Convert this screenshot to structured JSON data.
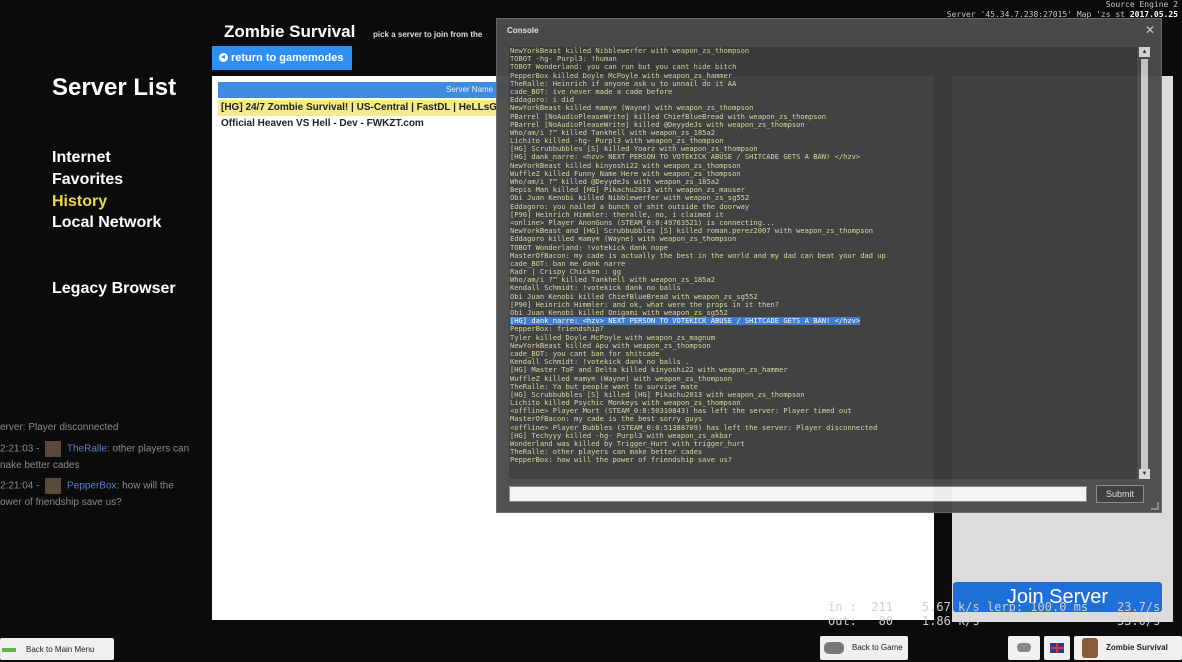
{
  "hud": {
    "engine": "Source Engine 2",
    "server_info": "Server '45.34.7.238:27015' Map 'zs_st",
    "date": "2017.05.25"
  },
  "left_menu": {
    "title": "Server List",
    "items": [
      "Internet",
      "Favorites",
      "History",
      "Local Network"
    ],
    "active": "History",
    "legacy": "Legacy Browser"
  },
  "bg_chat": {
    "line1": "erver: Player disconnected",
    "line2_time": "2:21:03 -",
    "line2_name": "TheRalle",
    "line2_text": ": other players can",
    "line3": "nake better cades",
    "line4_time": "2:21:04 -",
    "line4_name": "PepperBox",
    "line4_text": ": how will the",
    "line5": "ower of friendship save us?"
  },
  "browser": {
    "title": "Zombie Survival",
    "subtitle": "pick a server to join from the",
    "return_label": "return to gamemodes",
    "column_header": "Server Name",
    "servers": [
      "[HG] 24/7 Zombie Survival! | US-Central | FastDL | HeLLsGa",
      "Official Heaven VS Hell - Dev - FWKZT.com"
    ],
    "join_label": "Join Server"
  },
  "netgraph": {
    "line1": "in :  211    5.67 k/s lerp: 100.0 ms    23.7/s",
    "line2": "out:   80    1.86 k/s                   33.0/s"
  },
  "bottom": {
    "back_main": "Back to Main Menu",
    "back_game": "Back to Game",
    "gamemode": "Zombie Survival"
  },
  "console": {
    "title": "Console",
    "submit": "Submit",
    "input_value": "",
    "colors": {
      "name_red": "#e04040",
      "name_blue": "#4a90e0",
      "name_green": "#40c040",
      "text": "#d6d6a0"
    },
    "lines": [
      "NewYorkBeast killed Nibblewerfer with weapon_zs_thompson",
      "TOBOT -hg- Purpl3: !human",
      "TOBOT Wonderland: you can run but you cant hide bitch",
      "PepperBox killed Doyle McPoyle with weapon_zs_hammer",
      "TheRalle: Heinrich if anyone ask u to unnail do it AA",
      "cade_BOT: ive never made a cade before",
      "Eddagoro: i did",
      "NewYorkBeast killed ≋amy≋ (Wayne) with weapon_zs_thompson",
      "PBarrel [NoAudioPleaseWrite] killed ChiefBlueBread with weapon_zs_thompson",
      "PBarrel [NoAudioPleaseWrite] killed @DeyydeJs with weapon_zs_thompson",
      "Who/am/i ?™ killed Tankhell with weapon_zs_185a2",
      "Lichito killed -hg- Purpl3 with weapon_zs_thompson",
      "[HG] Scrubbubbles [S] killed Yoarz with weapon_zs_thompson",
      "[HG] dank_narre: <hzv> NEXT PERSON TO VOTEKICK ABUSE / SHITCADE GETS A BAN! </hzv>",
      "NewYorkBeast killed kinyoshi22 with weapon_zs_thompson",
      "WuffleZ killed Funny Name Here with weapon_zs_thompson",
      "Who/am/i ?™ killed @DeyydeJs with weapon_zs_185a2",
      "Bepis Man killed [HG] Pikachu2013 with weapon_zs_mauser",
      "Obi Juan Kenobi killed Nibblewerfer with weapon_zs_sg552",
      "Eddagoro: you nailed a bunch of shit outside the doorway",
      "[P90] Heinrich Himmler: theralle, no, i claimed it",
      "<online> Player AnonGuns (STEAM_0:0:49763521) is connecting...",
      "NewYorkBeast and [HG] Scrubbubbles [S] killed roman.perez2007 with weapon_zs_thompson",
      "Eddagoro killed ≋amy≋ (Wayne) with weapon_zs_thompson",
      "TOBOT Wonderland: !votekick dank nope",
      "MasterOfBacon: my cade is actually the best in the world and my dad can beat your dad up",
      "cade_BOT: ban me dank narre",
      "Radr | Crispy Chicken : gg",
      "Who/am/i ?™ killed Tankhell with weapon_zs_185a2",
      "Kendall Schmidt: !votekick dank no balls",
      "Obi Juan Kenobi killed ChiefBlueBread with weapon_zs_sg552",
      "[P90] Heinrich Himmler: and ok, what were the props in it then?",
      "Obi Juan Kenobi killed Onigami with weapon_zs_sg552",
      "[HG] dank_narre: <hzv> NEXT PERSON TO VOTEKICK ABUSE / SHITCADE GETS A BAN! </hzv>",
      "PepperBox: friendship?",
      "Tyler killed Doyle McPoyle with weapon_zs_magnum",
      "NewYorkBeast killed Apu with weapon_zs_thompson",
      "cade_BOT: you cant ban for shitcade",
      "Kendall Schmidt: !votekick dank no balls .",
      "[HG] Master ToF and Delta killed kinyoshi22 with weapon_zs_hammer",
      "WuffleZ killed ≋amy≋ (Wayne) with weapon_zs_thompson",
      "TheRalle: Ya but people want to survive mate",
      "[HG] Scrubbubbles [S] killed [HG] Pikachu2013 with weapon_zs_thompson",
      "Lichito killed Psychic Monkeys with weapon_zs_thompson",
      "<offline> Player Mort (STEAM_0:0:50310843) has left the server: Player timed out",
      "MasterOfBacon: my cade is the best sorry guys",
      "<offline> Player Bubbles (STEAM_0:0:51388709) has left the server: Player disconnected",
      "[HG] Techyyy killed -hg- Purpl3 with weapon_zs_akbar",
      "Wonderland was killed by Trigger_Hurt with trigger_hurt",
      "TheRalle: other players can make better cades",
      "PepperBox: how will the power of friendship save us?"
    ],
    "highlight_index": 33
  }
}
